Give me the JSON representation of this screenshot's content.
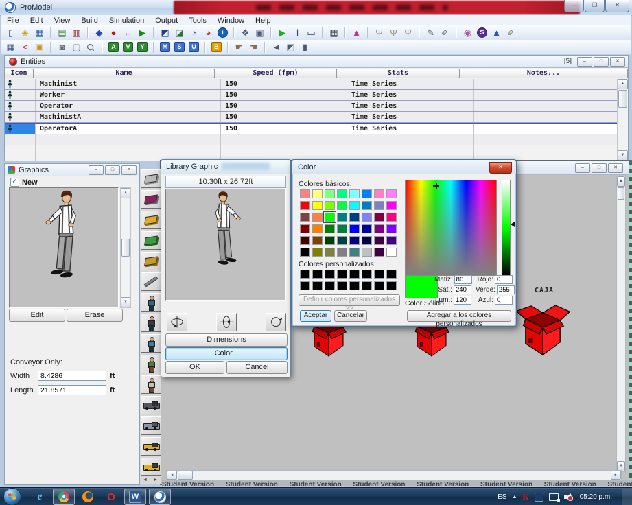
{
  "app": {
    "title": "ProModel"
  },
  "controls": {
    "minimize": "—",
    "maximize": "❐",
    "close": "✕",
    "min2": "–",
    "max2": "□",
    "up": "▲",
    "down": "▼",
    "left": "◄",
    "right": "►",
    "check": "✓"
  },
  "menu": [
    "File",
    "Edit",
    "View",
    "Build",
    "Simulation",
    "Output",
    "Tools",
    "Window",
    "Help"
  ],
  "toolbar1": [
    [
      {
        "n": "new-model-icon",
        "g": "▯",
        "c": "#44506a"
      },
      {
        "n": "open-model-icon",
        "g": "◈",
        "c": "#d99f1b"
      },
      {
        "n": "save-model-icon",
        "g": "▦",
        "c": "#2a5fa8"
      }
    ],
    [
      {
        "n": "view-text-icon",
        "g": "▤",
        "c": "#3f7d2f"
      },
      {
        "n": "print-icon",
        "g": "▥",
        "c": "#9a2f2f"
      }
    ],
    [
      {
        "n": "locations-icon",
        "g": "◆",
        "c": "#2244cc"
      },
      {
        "n": "entities-icon",
        "g": "●",
        "c": "#cc1111"
      },
      {
        "n": "path-networks-icon",
        "g": "←",
        "c": "#cc2222"
      },
      {
        "n": "resources-icon",
        "g": "▶",
        "c": "#1d8a1d"
      }
    ],
    [
      {
        "n": "processing-icon",
        "g": "◩",
        "c": "#1c3f8f"
      },
      {
        "n": "arrivals-icon",
        "g": "◪",
        "c": "#2f6f2f"
      },
      {
        "n": "shifts-icon",
        "g": "◔",
        "c": "#2a6fb0"
      },
      {
        "n": "shift-assignments-icon",
        "g": "◕",
        "c": "#b03030"
      },
      {
        "n": "model-info-icon",
        "g": "i",
        "c": "#ffffff",
        "b": "#1565c0",
        "r": true
      }
    ],
    [
      {
        "n": "simulation-options-icon",
        "g": "❖",
        "c": "#4a5a74"
      },
      {
        "n": "scenario-manager-icon",
        "g": "▣",
        "c": "#4a5a74"
      }
    ],
    [
      {
        "n": "run-simulation-icon",
        "g": "▶",
        "c": "#1faf1f"
      },
      {
        "n": "pause-simulation-icon",
        "g": "‖",
        "c": "#33425c"
      },
      {
        "n": "animation-off-icon",
        "g": "▭",
        "c": "#33425c"
      }
    ],
    [
      {
        "n": "output-viewer-icon",
        "g": "▦",
        "c": "#3a3f4a"
      }
    ],
    [
      {
        "n": "stat-fit-icon",
        "g": "▲",
        "c": "#c03a8c"
      }
    ],
    [
      {
        "n": "pointer-tool-icon",
        "g": "Ψ",
        "c": "#9a9a86"
      },
      {
        "n": "connection-tool-icon",
        "g": "Ψ",
        "c": "#9a9a86"
      },
      {
        "n": "path-tool-icon",
        "g": "Ψ",
        "c": "#9a9a86"
      }
    ],
    [
      {
        "n": "edit-tables-icon",
        "g": "✎",
        "c": "#55606e"
      },
      {
        "n": "edit-notes-icon",
        "g": "✐",
        "c": "#55606e"
      }
    ],
    [
      {
        "n": "graphics-editor-icon",
        "g": "◉",
        "c": "#b3559c"
      },
      {
        "n": "simrunner-icon",
        "g": "S",
        "c": "#ffffff",
        "b": "#5b2d8e",
        "r": true
      },
      {
        "n": "stat-fit-triangle-icon",
        "g": "▲",
        "c": "#2a52c4"
      },
      {
        "n": "quick-notes-icon",
        "g": "✐",
        "c": "#7a6a4a"
      }
    ]
  ],
  "toolbar2": [
    [
      {
        "n": "table-view-icon",
        "g": "▦",
        "c": "#4a5a8a"
      },
      {
        "n": "dynamic-plots-icon",
        "g": "<",
        "c": "#cc2222"
      },
      {
        "n": "open-folder-icon",
        "g": "▣",
        "c": "#c8901a"
      }
    ],
    [
      {
        "n": "record-animation-icon",
        "g": "◙",
        "c": "#6a6a72"
      },
      {
        "n": "views-icon",
        "g": "▢",
        "c": "#4a5a74"
      },
      {
        "n": "zoom-icon",
        "g": "Ϙ",
        "c": "#55606e",
        "rot": true
      }
    ],
    [
      {
        "n": "attributes-icon",
        "g": "A",
        "c": "#ffffff",
        "b": "#2e8b2e"
      },
      {
        "n": "variables-icon",
        "g": "V",
        "c": "#ffffff",
        "b": "#2e8b2e"
      },
      {
        "n": "arrays-icon",
        "g": "Y",
        "c": "#ffffff",
        "b": "#2e8b2e"
      }
    ],
    [
      {
        "n": "macros-icon",
        "g": "M",
        "c": "#ffffff",
        "b": "#3b6fd4"
      },
      {
        "n": "subroutines-icon",
        "g": "S",
        "c": "#ffffff",
        "b": "#3b6fd4"
      },
      {
        "n": "user-distributions-icon",
        "g": "U",
        "c": "#ffffff",
        "b": "#3b6fd4"
      }
    ],
    [
      {
        "n": "bills-of-material-icon",
        "g": "B",
        "c": "#ffffff",
        "b": "#e8a000"
      }
    ],
    [
      {
        "n": "paint-region-icon",
        "g": "☛",
        "c": "#8a6a4a"
      },
      {
        "n": "stamp-tool-icon",
        "g": "☚",
        "c": "#8a6a4a"
      }
    ],
    [
      {
        "n": "reset-window-icon",
        "g": "◄",
        "c": "#4a5a74"
      },
      {
        "n": "tile-windows-icon",
        "g": "◩",
        "c": "#4a5a74"
      },
      {
        "n": "zoom-to-fit-icon",
        "g": "▮",
        "c": "#4a5a74"
      }
    ]
  ],
  "entities": {
    "title": "Entities",
    "badge": "[5]",
    "columns": [
      "Icon",
      "Name",
      "Speed (fpm)",
      "Stats",
      "Notes..."
    ],
    "rows": [
      {
        "name": "Machinist",
        "speed": "150",
        "stats": "Time Series",
        "notes": ""
      },
      {
        "name": "Worker",
        "speed": "150",
        "stats": "Time Series",
        "notes": ""
      },
      {
        "name": "Operator",
        "speed": "150",
        "stats": "Time Series",
        "notes": ""
      },
      {
        "name": "MachinistA",
        "speed": "150",
        "stats": "Time Series",
        "notes": ""
      },
      {
        "name": "OperatorA",
        "speed": "150",
        "stats": "Time Series",
        "notes": ""
      }
    ],
    "selected_row": 4
  },
  "graphics": {
    "title": "Graphics",
    "new_label": "New",
    "edit": "Edit",
    "erase": "Erase",
    "conveyor": "Conveyor Only:",
    "width_label": "Width",
    "width": "8.4286",
    "length_label": "Length",
    "length": "21.8571",
    "unit": "ft"
  },
  "library_strip": [
    {
      "name": "slab-graphic",
      "t": "box",
      "c1": "#b9b9b9",
      "c2": "#8b8b8b"
    },
    {
      "name": "cart-graphic",
      "t": "box",
      "c1": "#8b2060",
      "c2": "#6b6b6b"
    },
    {
      "name": "crate-graphic",
      "t": "box",
      "c1": "#e0aa2a",
      "c2": "#9a7215"
    },
    {
      "name": "money-graphic",
      "t": "box",
      "c1": "#3f9a3f",
      "c2": "#1f6a1f"
    },
    {
      "name": "pallet-graphic",
      "t": "box",
      "c1": "#c89a2a",
      "c2": "#8a6a15"
    },
    {
      "name": "rod-graphic",
      "t": "rod",
      "c1": "#9aa0a8",
      "c2": "#5a6068"
    },
    {
      "name": "worker-blue-graphic",
      "t": "person",
      "c1": "#2d6a8a",
      "c2": "#14323c"
    },
    {
      "name": "worker-dark-graphic",
      "t": "person",
      "c1": "#3a3a42",
      "c2": "#14323c"
    },
    {
      "name": "worker-teal-graphic",
      "t": "person",
      "c1": "#3a7d9c",
      "c2": "#14323c"
    },
    {
      "name": "carrier-box-graphic",
      "t": "person",
      "c1": "#4a7a3a",
      "c2": "#6b4a2b"
    },
    {
      "name": "carrier-sack-graphic",
      "t": "person",
      "c1": "#c8c0b0",
      "c2": "#6b4a2b"
    },
    {
      "name": "truck-graphic",
      "t": "vehicle",
      "c1": "#55585e",
      "c2": "#2e3034"
    },
    {
      "name": "pickup-graphic",
      "t": "vehicle",
      "c1": "#8a95a5",
      "c2": "#4a5560"
    },
    {
      "name": "pallet-jack-graphic",
      "t": "vehicle",
      "c1": "#e0b020",
      "c2": "#2e3034"
    },
    {
      "name": "forklift-graphic",
      "t": "vehicle",
      "c1": "#e0b020",
      "c2": "#3a3a3a"
    }
  ],
  "library_dialog": {
    "title": "Library Graphic",
    "size_text": "10.30ft x 26.72ft",
    "dimensions": "Dimensions",
    "color": "Color...",
    "ok": "OK",
    "cancel": "Cancel"
  },
  "color_dialog": {
    "title": "Color",
    "basic_label": "Colores básicos:",
    "custom_label": "Colores personalizados:",
    "define_custom": "Definir colores personalizados >>",
    "accept": "Aceptar",
    "cancel": "Cancelar",
    "add_custom": "Agregar a los colores personalizados",
    "solid_label": "Color|Sólido",
    "selected_color": "#00FF00",
    "selected_index": 18,
    "basic_colors": [
      "#FF8080",
      "#FFFF80",
      "#80FF80",
      "#00FF80",
      "#80FFFF",
      "#0080FF",
      "#FF80C0",
      "#FF80FF",
      "#FF0000",
      "#FFFF00",
      "#80FF00",
      "#00FF40",
      "#00FFFF",
      "#0080C0",
      "#8080C0",
      "#FF00FF",
      "#804040",
      "#FF8040",
      "#00FF00",
      "#008080",
      "#004080",
      "#8080FF",
      "#800040",
      "#FF0080",
      "#800000",
      "#FF8000",
      "#008000",
      "#008040",
      "#0000FF",
      "#0000A0",
      "#800080",
      "#8000FF",
      "#400000",
      "#804000",
      "#004000",
      "#004040",
      "#000080",
      "#000040",
      "#400040",
      "#400080",
      "#000000",
      "#808000",
      "#808040",
      "#808080",
      "#408080",
      "#C0C0C0",
      "#400040",
      "#FFFFFF"
    ],
    "custom_color": "#000000",
    "custom_count": 16,
    "hsl_fields": [
      {
        "label": "Matiz:",
        "value": "80"
      },
      {
        "label": "Sat.:",
        "value": "240"
      },
      {
        "label": "Lum.:",
        "value": "120"
      }
    ],
    "rgb_fields": [
      {
        "label": "Rojo:",
        "value": "0"
      },
      {
        "label": "Verde:",
        "value": "255"
      },
      {
        "label": "Azul:",
        "value": "0"
      }
    ]
  },
  "layout": {
    "caja": "CAJA",
    "watermark": "Student Version"
  },
  "taskbar": {
    "lang": "ES",
    "time": "05:20 p.m.",
    "pinned": [
      {
        "n": "internet-explorer-icon",
        "t": "ie"
      },
      {
        "n": "chrome-icon",
        "t": "chrome",
        "boxed": true
      },
      {
        "n": "firefox-icon",
        "t": "firefox"
      },
      {
        "n": "opera-icon",
        "t": "opera"
      },
      {
        "n": "word-icon",
        "t": "word",
        "boxed": true
      },
      {
        "n": "promodel-taskbar-icon",
        "t": "promodel",
        "boxed": true
      }
    ],
    "tray": [
      {
        "n": "show-hidden-icons-button",
        "t": "chevron"
      },
      {
        "n": "kaspersky-tray-icon",
        "t": "kaspersky"
      },
      {
        "n": "antivirus-tray-icon",
        "t": "shield"
      },
      {
        "n": "network-tray-icon",
        "t": "network"
      },
      {
        "n": "volume-muted-tray-icon",
        "t": "volume"
      }
    ]
  }
}
